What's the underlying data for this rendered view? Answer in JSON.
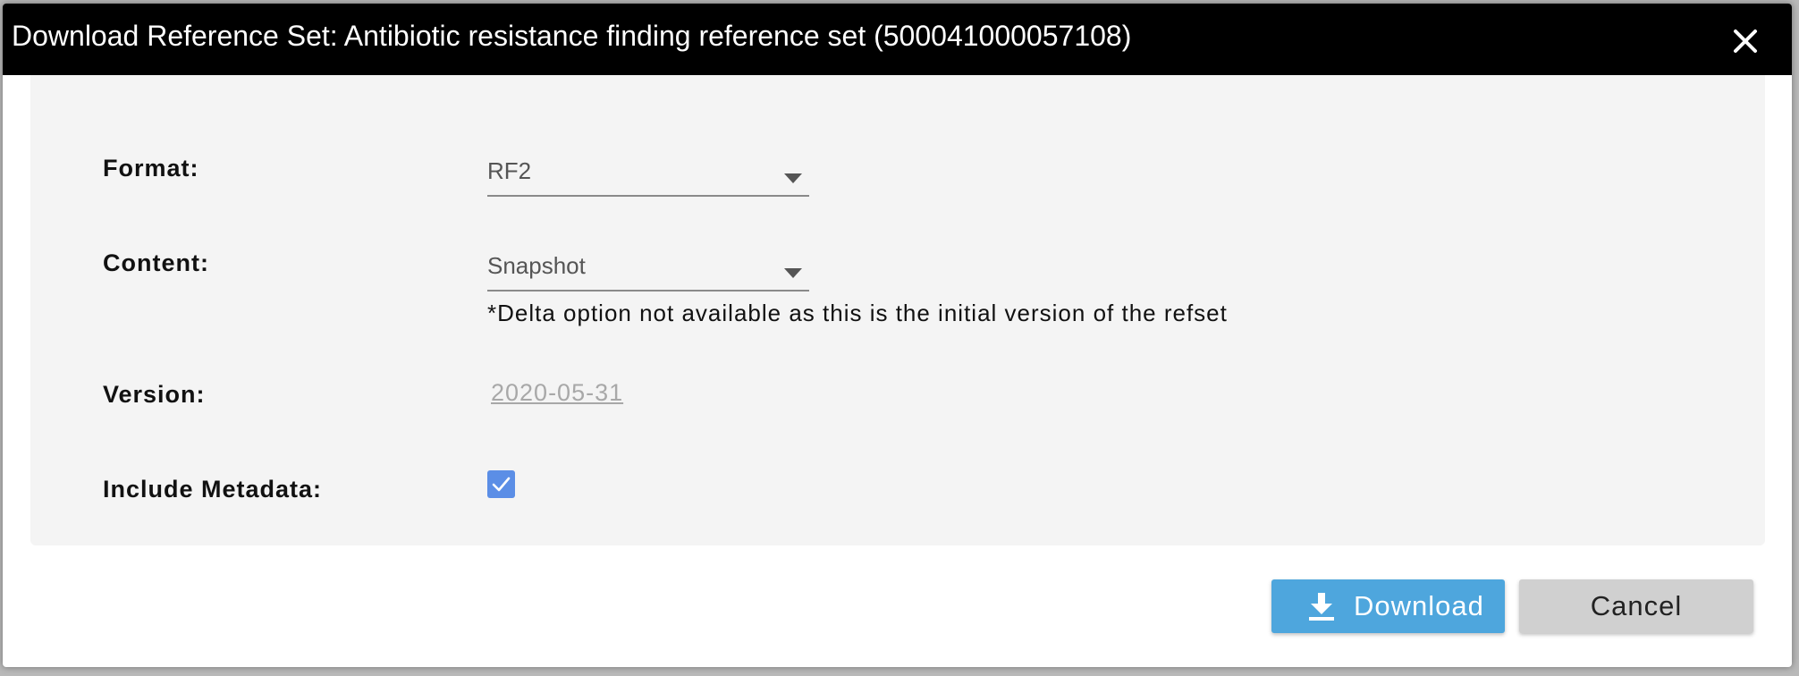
{
  "dialog": {
    "title": "Download Reference Set: Antibiotic resistance finding reference set (500041000057108)",
    "close_icon": "close-icon"
  },
  "form": {
    "format_label": "Format:",
    "format_value": "RF2",
    "content_label": "Content:",
    "content_value": "Snapshot",
    "content_note": "*Delta option not available as this is the initial version of the refset",
    "version_label": "Version:",
    "version_value": "2020-05-31",
    "metadata_label": "Include Metadata:",
    "metadata_checked": true
  },
  "actions": {
    "download_label": "Download",
    "download_icon": "download-icon",
    "cancel_label": "Cancel"
  },
  "colors": {
    "titlebar_bg": "#000000",
    "panel_bg": "#f4f4f4",
    "download_bg": "#4ea6dd",
    "cancel_bg": "#d0d0d0",
    "checkbox_bg": "#5b8ee6"
  }
}
